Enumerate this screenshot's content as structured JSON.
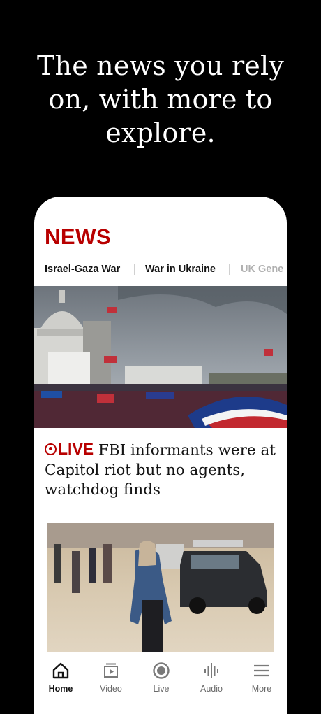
{
  "promo": {
    "line1": "The news you rely",
    "line2": "on, with more to",
    "line3": "explore."
  },
  "app": {
    "logo": "NEWS",
    "topics": [
      "Israel-Gaza War",
      "War in Ukraine",
      "UK Gene"
    ]
  },
  "top_story": {
    "live_label": "LIVE",
    "headline": "FBI informants were at Capitol riot but no agents, watchdog finds"
  },
  "tabbar": {
    "items": [
      {
        "label": "Home",
        "icon": "home-icon",
        "active": true
      },
      {
        "label": "Video",
        "icon": "video-icon",
        "active": false
      },
      {
        "label": "Live",
        "icon": "live-icon",
        "active": false
      },
      {
        "label": "Audio",
        "icon": "audio-icon",
        "active": false
      },
      {
        "label": "More",
        "icon": "menu-icon",
        "active": false
      }
    ]
  },
  "colors": {
    "brand_red": "#b80000",
    "background": "#000000",
    "card": "#ffffff"
  }
}
